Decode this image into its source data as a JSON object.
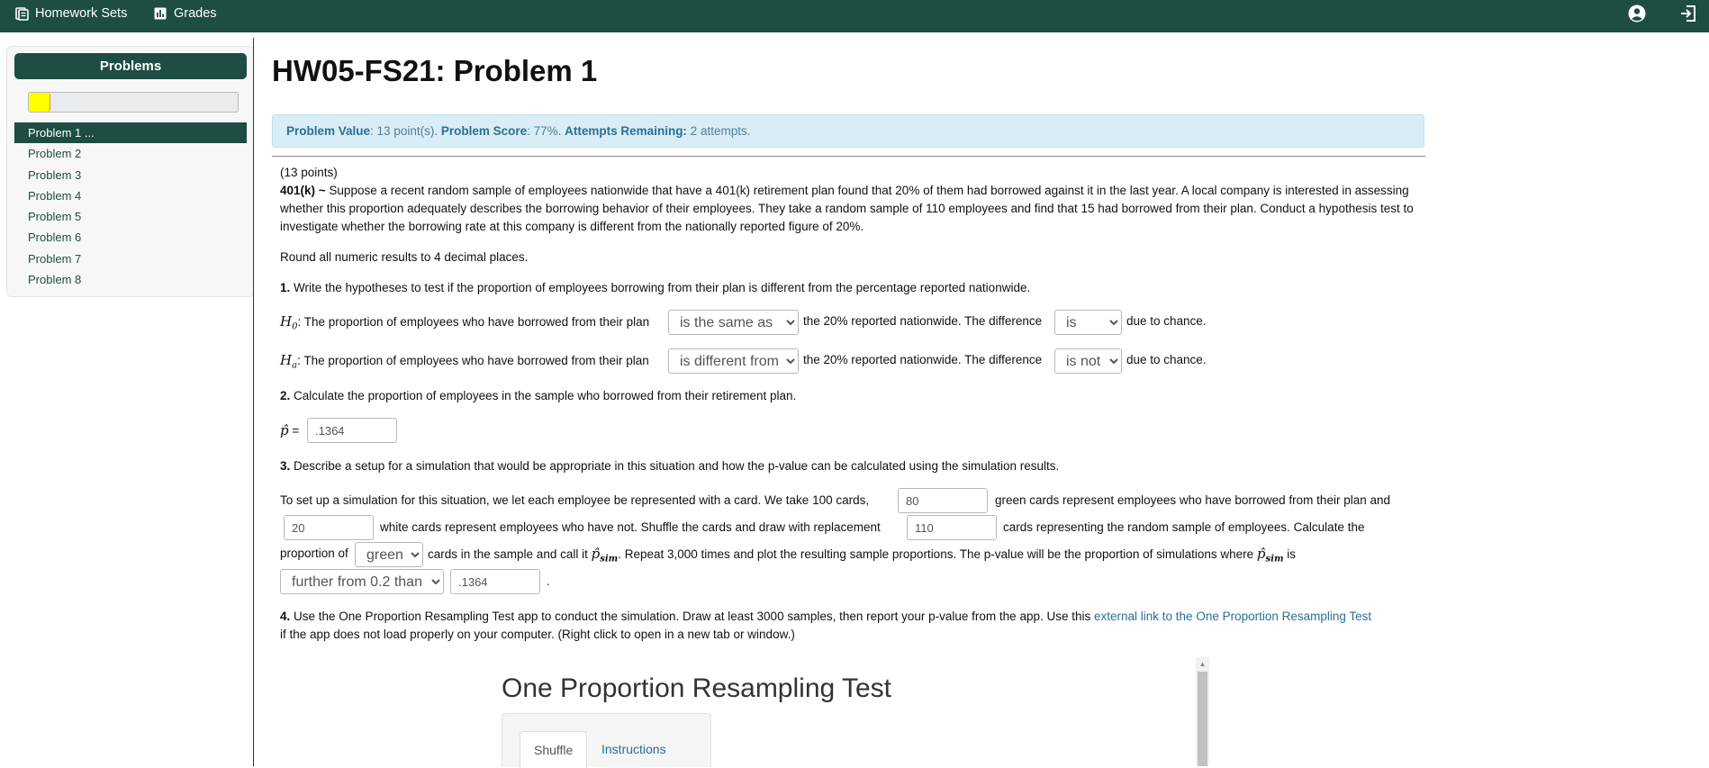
{
  "nav": {
    "homework_sets": "Homework Sets",
    "grades": "Grades",
    "icons": [
      "book-icon",
      "bar-chart-icon",
      "user-circle-icon",
      "sign-out-icon"
    ]
  },
  "sidebar": {
    "header": "Problems",
    "progress_fraction": 0.1,
    "items": [
      {
        "label": "Problem 1 ..."
      },
      {
        "label": "Problem 2"
      },
      {
        "label": "Problem 3"
      },
      {
        "label": "Problem 4"
      },
      {
        "label": "Problem 5"
      },
      {
        "label": "Problem 6"
      },
      {
        "label": "Problem 7"
      },
      {
        "label": "Problem 8"
      }
    ]
  },
  "page_title": "HW05-FS21: Problem 1",
  "info": {
    "value_label": "Problem Value",
    "value_text": ": 13 point(s). ",
    "score_label": "Problem Score",
    "score_text": ": 77%. ",
    "attempts_label": "Attempts Remaining:",
    "attempts_text": " 2 attempts."
  },
  "problem": {
    "points": "(13 points)",
    "intro_bold": "401(k) ~",
    "intro": " Suppose a recent random sample of employees nationwide that have a 401(k) retirement plan found that 20% of them had borrowed against it in the last year. A local company is interested in assessing whether this proportion adequately describes the borrowing behavior of their employees. They take a random sample of 110 employees and find that 15 had borrowed from their plan. Conduct a hypothesis test to investigate whether the borrowing rate at this company is different from the nationally reported figure of 20%.",
    "round": "Round all numeric results to 4 decimal places.",
    "q1_num": "1.",
    "q1": " Write the hypotheses to test if the proportion of employees borrowing from their plan is different from the percentage reported nationwide.",
    "h0_symbol": "H",
    "h0_sub": "0",
    "ha_symbol": "H",
    "ha_sub": "a",
    "h_text1": ": The proportion of employees who have borrowed from their plan",
    "h_text2": "the 20% reported nationwide. The difference",
    "h_text3": "due to chance.",
    "h0_select": "is the same as",
    "h0_diff_select": "is",
    "ha_select": "is different from",
    "ha_diff_select": "is not",
    "q2_num": "2.",
    "q2": " Calculate the proportion of employees in the sample who borrowed from their retirement plan.",
    "phat_symbol": "p̂",
    "phat_eq": "=",
    "phat_value": ".1364",
    "q3_num": "3.",
    "q3": " Describe a setup for a simulation that would be appropriate in this situation and how the p-value can be calculated using the simulation results.",
    "sim_t1": "To set up a simulation for this situation, we let each employee be represented with a card. We take 100 cards,",
    "sim_green_value": "80",
    "sim_t2": "green cards represent employees who have borrowed from their plan and",
    "sim_white_value": "20",
    "sim_t3": "white cards represent employees who have not. Shuffle the cards and draw with replacement",
    "sim_draw_value": "110",
    "sim_t4": "cards representing the random sample of employees. Calculate the",
    "sim_t5": "proportion of",
    "color_select": "green",
    "sim_t6": "cards in the sample and call it",
    "psim_symbol": "p̂",
    "psim_sub": "sim",
    "sim_t7": ". Repeat 3,000 times and plot the resulting sample proportions. The p-value will be the proportion of simulations where",
    "sim_t8": "is",
    "further_select": "further from 0.2 than",
    "further_value": ".1364",
    "sim_period": ".",
    "q4_num": "4.",
    "q4a": " Use the One Proportion Resampling Test app to conduct the simulation. Draw at least 3000 samples, then report your p-value from the app. Use this ",
    "q4_link": "external link to the One Proportion Resampling Test",
    "q4b": "if the app does not load properly on your computer. (Right click to open in a new tab or window.)"
  },
  "app": {
    "title": "One Proportion Resampling Test",
    "tabs": [
      "Shuffle",
      "Instructions"
    ]
  }
}
